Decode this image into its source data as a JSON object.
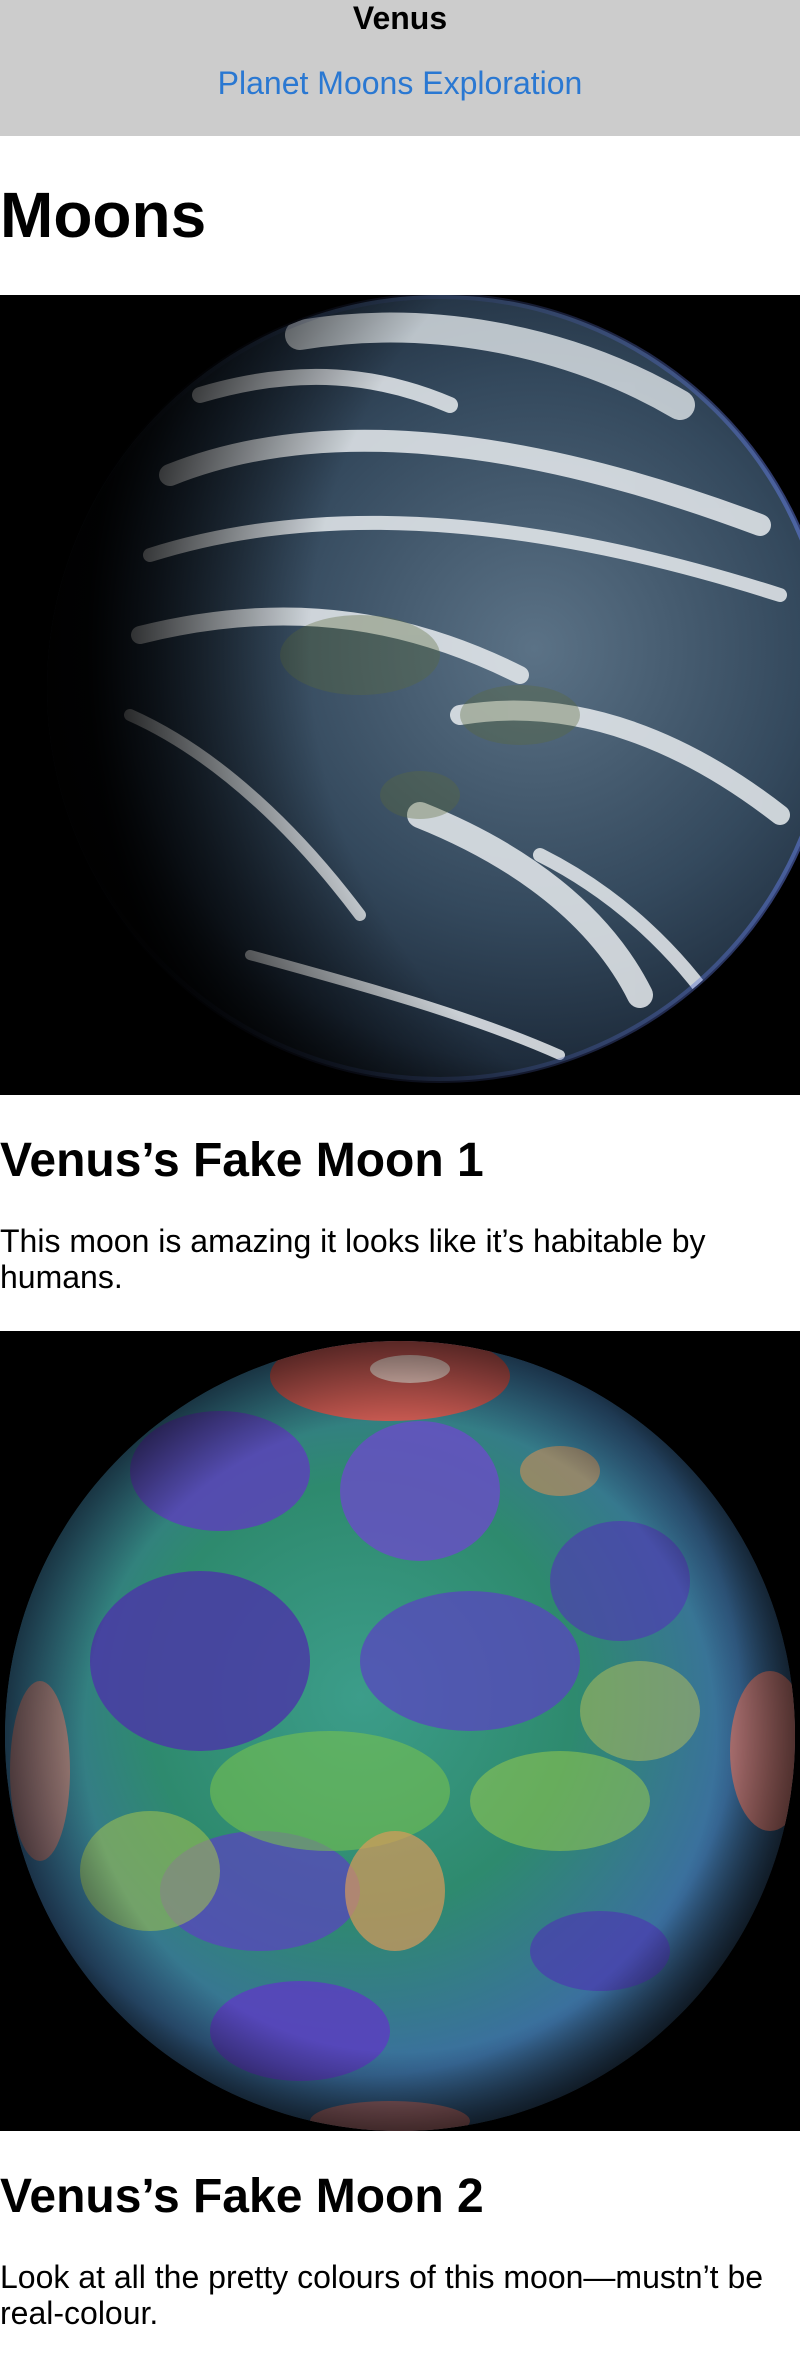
{
  "header": {
    "site_title": "Venus",
    "nav_link": "Planet Moons Exploration"
  },
  "main": {
    "page_title": "Moons",
    "moons": [
      {
        "name": "Venus’s Fake Moon 1",
        "description": "This moon is amazing it looks like it’s habitable by humans.",
        "image": "earth-like-moon-image"
      },
      {
        "name": "Venus’s Fake Moon 2",
        "description": "Look at all the pretty colours of this moon—mustn’t be real-colour.",
        "image": "false-colour-moon-image"
      }
    ]
  },
  "colors": {
    "header_bg": "#cccccc",
    "link": "#2a78d2",
    "image_bg": "#000000"
  }
}
